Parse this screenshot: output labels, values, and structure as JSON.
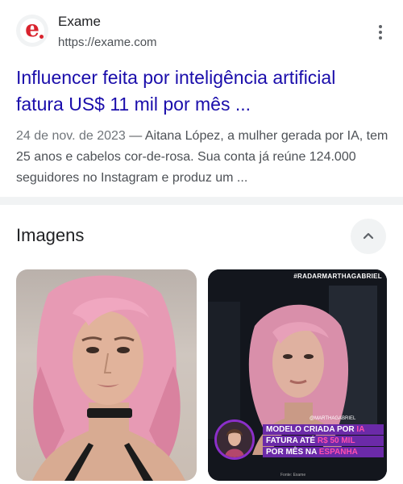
{
  "result": {
    "site_name": "Exame",
    "site_url": "https://exame.com",
    "favicon_letter": "e",
    "headline_line1": "Influencer feita por inteligência artificial",
    "headline_line2": "fatura US$ 11 mil por mês ...",
    "snippet_date": "24 de nov. de 2023",
    "snippet_text": " — Aitana López, a mulher gerada por IA, tem 25 anos e cabelos cor-de-rosa. Sua conta já reúne 124.000 seguidores no Instagram e produz um ..."
  },
  "images_section": {
    "title": "Imagens"
  },
  "thumb2_overlay": {
    "tag": "#RADARMARTHAGABRIEL",
    "handle": "@MARTHAGABRIEL",
    "caption_line1_a": "MODELO CRIADA POR ",
    "caption_line1_b": "IA",
    "caption_line2_a": "FATURA ATÉ ",
    "caption_line2_b": "R$ 50 MIL",
    "caption_line3_a": "POR MÊS NA ",
    "caption_line3_b": "ESPANHA",
    "credit": "Fonte: Exame"
  },
  "colors": {
    "link": "#1a0dab",
    "brand_red": "#d9232d",
    "caption_purple": "#6b2aa8",
    "caption_pink": "#ff4fb0"
  },
  "icons": [
    "exame-logo-icon",
    "more-vert-icon",
    "chevron-up-icon"
  ]
}
